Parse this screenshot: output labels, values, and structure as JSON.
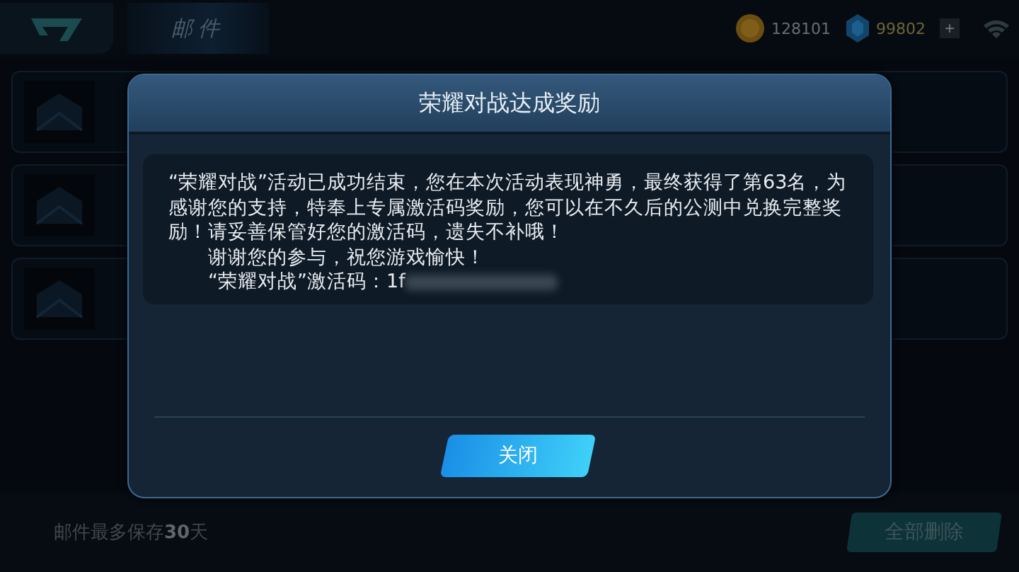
{
  "top_bar": {
    "title": "邮件",
    "gold": "128101",
    "diamonds": "99802",
    "add_button": "+"
  },
  "mail_rows": [
    {
      "kind": "mail"
    },
    {
      "kind": "mail"
    },
    {
      "kind": "mail"
    }
  ],
  "footer": {
    "note": "邮件最多保存**30**天",
    "delete_all_button": "全部删除"
  },
  "dialog": {
    "title": "荣耀对战达成奖励",
    "message": "“荣耀对战”活动已成功结束，您在本次活动表现神勇，最终获得了第63名，为感谢您的支持，特奉上专属激活码奖励，您可以在不久后的公测中兑换完整奖励！请妥善保管好您的激活码，遗失不补哦！",
    "thanks": "谢谢您的参与，祝您游戏愉快！",
    "code_line": "“荣耀对战”激活码：1f",
    "close_button": "关闭"
  }
}
